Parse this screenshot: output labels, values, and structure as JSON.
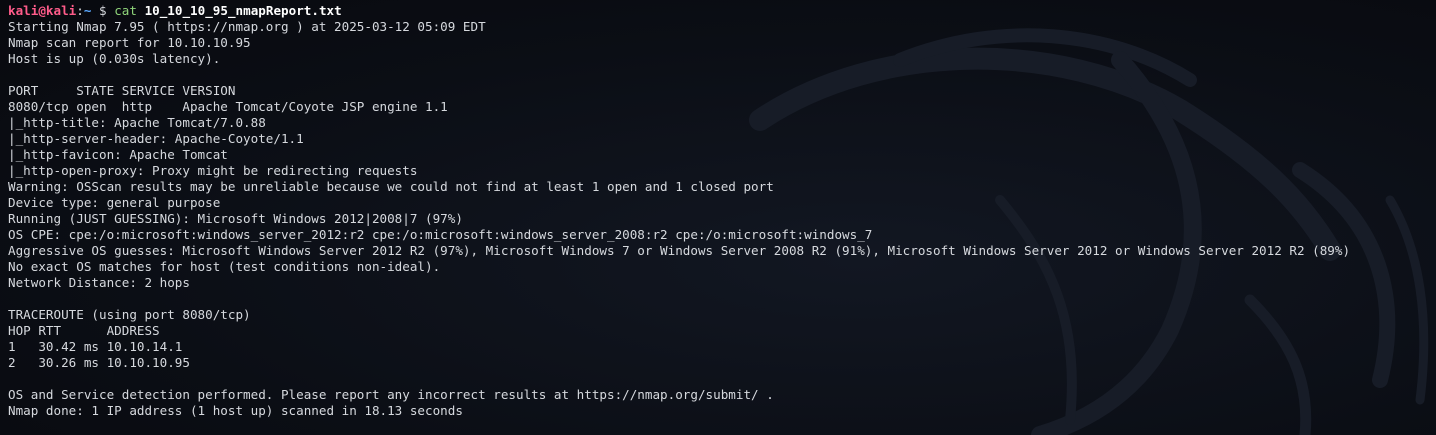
{
  "prompt": {
    "user": "kali@kali",
    "colon": ":",
    "path": "~",
    "symbol": "$",
    "command": "cat",
    "argument": "10_10_10_95_nmapReport.txt"
  },
  "output_lines": [
    "Starting Nmap 7.95 ( https://nmap.org ) at 2025-03-12 05:09 EDT",
    "Nmap scan report for 10.10.10.95",
    "Host is up (0.030s latency).",
    "",
    "PORT     STATE SERVICE VERSION",
    "8080/tcp open  http    Apache Tomcat/Coyote JSP engine 1.1",
    "|_http-title: Apache Tomcat/7.0.88",
    "|_http-server-header: Apache-Coyote/1.1",
    "|_http-favicon: Apache Tomcat",
    "|_http-open-proxy: Proxy might be redirecting requests",
    "Warning: OSScan results may be unreliable because we could not find at least 1 open and 1 closed port",
    "Device type: general purpose",
    "Running (JUST GUESSING): Microsoft Windows 2012|2008|7 (97%)",
    "OS CPE: cpe:/o:microsoft:windows_server_2012:r2 cpe:/o:microsoft:windows_server_2008:r2 cpe:/o:microsoft:windows_7",
    "Aggressive OS guesses: Microsoft Windows Server 2012 R2 (97%), Microsoft Windows 7 or Windows Server 2008 R2 (91%), Microsoft Windows Server 2012 or Windows Server 2012 R2 (89%)",
    "No exact OS matches for host (test conditions non-ideal).",
    "Network Distance: 2 hops",
    "",
    "TRACEROUTE (using port 8080/tcp)",
    "HOP RTT      ADDRESS",
    "1   30.42 ms 10.10.14.1",
    "2   30.26 ms 10.10.10.95",
    "",
    "OS and Service detection performed. Please report any incorrect results at https://nmap.org/submit/ .",
    "Nmap done: 1 IP address (1 host up) scanned in 18.13 seconds"
  ],
  "colors": {
    "background": "#0c0f17",
    "text": "#d6d9de",
    "prompt_user": "#ff5c8a",
    "prompt_path": "#5aa8ff",
    "command": "#8fd47a"
  },
  "icons": {
    "background": "kali-dragon-watermark"
  }
}
